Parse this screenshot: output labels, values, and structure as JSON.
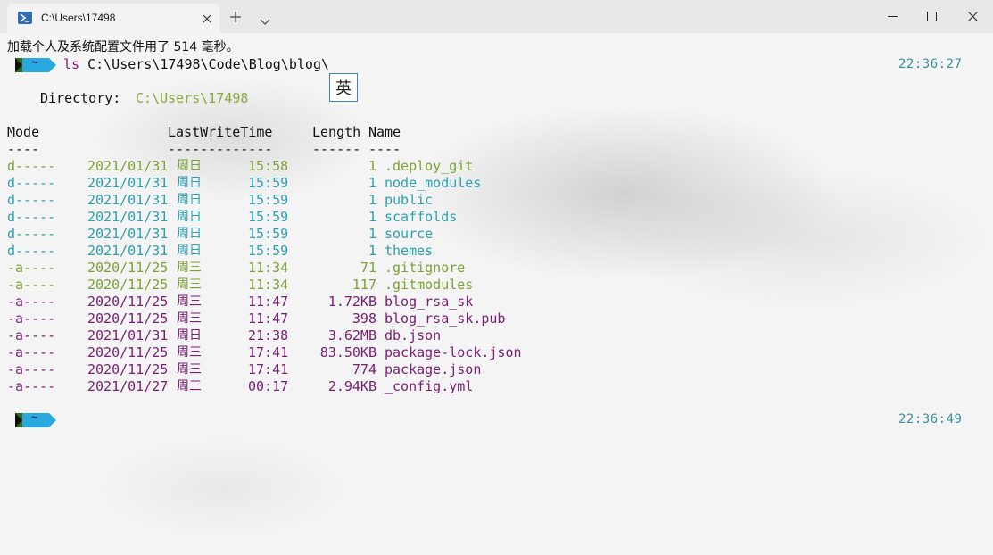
{
  "window": {
    "tab_title": "C:\\Users\\17498",
    "tab_icon": "powershell-icon"
  },
  "terminal": {
    "load_message": "加载个人及系统配置文件用了 514 毫秒。",
    "prompt_symbol": "~",
    "command_keyword": "ls",
    "command_args": "C:\\Users\\17498\\Code\\Blog\\blog\\",
    "time1": "22:36:27",
    "time2": "22:36:49",
    "ime_indicator": "英",
    "directory_label": "Directory:",
    "directory_path": "C:\\Users\\17498",
    "headers": {
      "mode": "Mode",
      "lastwritetime": "LastWriteTime",
      "length": "Length",
      "name": "Name"
    },
    "separators": {
      "mode": "----",
      "lastwritetime": "-------------",
      "length": "------",
      "name": "----"
    },
    "colors": {
      "dir_green": "#7da134",
      "dir_teal": "#2aa1b3",
      "file_purple": "#7a1d75",
      "time": "#3a8fa0"
    },
    "rows": [
      {
        "mode": "d-----",
        "date": "2021/01/31",
        "day": "周日",
        "time": "15:58",
        "length": "1",
        "name": ".deploy_git",
        "color": "green"
      },
      {
        "mode": "d-----",
        "date": "2021/01/31",
        "day": "周日",
        "time": "15:59",
        "length": "1",
        "name": "node_modules",
        "color": "teal"
      },
      {
        "mode": "d-----",
        "date": "2021/01/31",
        "day": "周日",
        "time": "15:59",
        "length": "1",
        "name": "public",
        "color": "teal"
      },
      {
        "mode": "d-----",
        "date": "2021/01/31",
        "day": "周日",
        "time": "15:59",
        "length": "1",
        "name": "scaffolds",
        "color": "teal"
      },
      {
        "mode": "d-----",
        "date": "2021/01/31",
        "day": "周日",
        "time": "15:59",
        "length": "1",
        "name": "source",
        "color": "teal"
      },
      {
        "mode": "d-----",
        "date": "2021/01/31",
        "day": "周日",
        "time": "15:59",
        "length": "1",
        "name": "themes",
        "color": "teal"
      },
      {
        "mode": "-a----",
        "date": "2020/11/25",
        "day": "周三",
        "time": "11:34",
        "length": "71",
        "name": ".gitignore",
        "color": "green"
      },
      {
        "mode": "-a----",
        "date": "2020/11/25",
        "day": "周三",
        "time": "11:34",
        "length": "117",
        "name": ".gitmodules",
        "color": "green"
      },
      {
        "mode": "-a----",
        "date": "2020/11/25",
        "day": "周三",
        "time": "11:47",
        "length": "1.72KB",
        "name": "blog_rsa_sk",
        "color": "purple"
      },
      {
        "mode": "-a----",
        "date": "2020/11/25",
        "day": "周三",
        "time": "11:47",
        "length": "398",
        "name": "blog_rsa_sk.pub",
        "color": "purple"
      },
      {
        "mode": "-a----",
        "date": "2021/01/31",
        "day": "周日",
        "time": "21:38",
        "length": "3.62MB",
        "name": "db.json",
        "color": "purple"
      },
      {
        "mode": "-a----",
        "date": "2020/11/25",
        "day": "周三",
        "time": "17:41",
        "length": "83.50KB",
        "name": "package-lock.json",
        "color": "purple"
      },
      {
        "mode": "-a----",
        "date": "2020/11/25",
        "day": "周三",
        "time": "17:41",
        "length": "774",
        "name": "package.json",
        "color": "purple"
      },
      {
        "mode": "-a----",
        "date": "2021/01/27",
        "day": "周三",
        "time": "00:17",
        "length": "2.94KB",
        "name": "_config.yml",
        "color": "purple"
      }
    ]
  }
}
